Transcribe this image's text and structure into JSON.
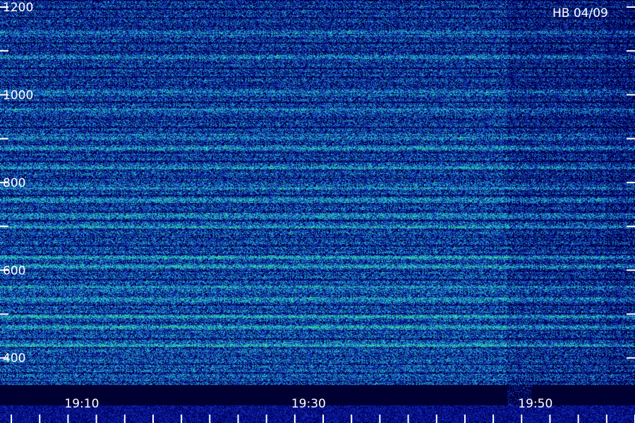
{
  "chart_data": {
    "type": "heatmap",
    "title": "HB 04/09",
    "xlabel": "",
    "ylabel": "",
    "x_tick_labels": [
      "19:10",
      "19:30",
      "19:50"
    ],
    "x_tick_values_min": [
      10,
      30,
      50
    ],
    "x_range_min": [
      4,
      60
    ],
    "y_tick_labels": [
      "1200",
      "1000",
      "800",
      "600",
      "400"
    ],
    "y_tick_values": [
      1200,
      1000,
      800,
      600,
      400
    ],
    "y_range": [
      340,
      1200
    ],
    "y_minor_step": 100,
    "grid": false,
    "colormap": [
      "#000033",
      "#00007a",
      "#1a3fc8",
      "#1fa0c8",
      "#25d8b8",
      "#3af07a"
    ],
    "background": "#000000",
    "bright_band_frequencies": [
      1140,
      1085,
      1005,
      965,
      905,
      880,
      835,
      790,
      760,
      725,
      700,
      630,
      610,
      560,
      535,
      495,
      470,
      430
    ]
  }
}
